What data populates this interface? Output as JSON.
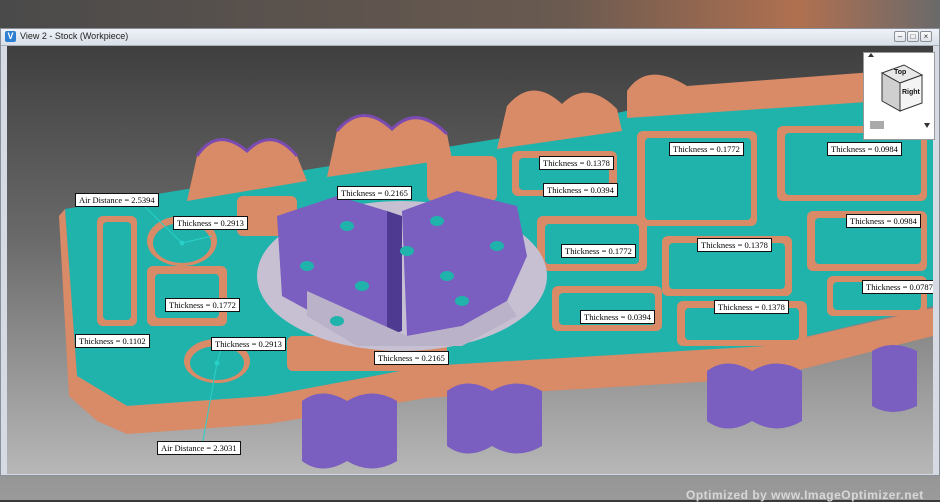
{
  "window": {
    "title": "View 2 - Stock (Workpiece)",
    "app_icon": "vericut-app-icon",
    "buttons": [
      "minimize",
      "maximize",
      "close"
    ]
  },
  "view_cube": {
    "top_label": "Top",
    "right_label": "Right"
  },
  "annotations": {
    "air_distance_top": "Air Distance = 2.5394",
    "air_distance_bottom": "Air Distance = 2.3031",
    "t_0_2913_top": "Thickness = 0.2913",
    "t_0_2913_bottom": "Thickness = 0.2913",
    "t_0_2165_top": "Thickness = 0.2165",
    "t_0_2165_bottom": "Thickness = 0.2165",
    "t_0_1772_left": "Thickness = 0.1772",
    "t_0_1102": "Thickness = 0.1102",
    "t_0_1378_a": "Thickness = 0.1378",
    "t_0_0394_a": "Thickness = 0.0394",
    "t_0_1772_mid": "Thickness = 0.1772",
    "t_0_0394_b": "Thickness = 0.0394",
    "t_0_1772_top": "Thickness = 0.1772",
    "t_0_1378_b": "Thickness = 0.1378",
    "t_0_1378_c": "Thickness = 0.1378",
    "t_0_0984_a": "Thickness = 0.0984",
    "t_0_0984_b": "Thickness = 0.0984",
    "t_0_0787": "Thickness = 0.0787"
  },
  "colors": {
    "teal": "#1fb3ac",
    "copper": "#d98a66",
    "purple": "#7a5fc0",
    "fixture_gray": "#b9b2c8"
  },
  "footer": "Optimized by www.ImageOptimizer.net"
}
